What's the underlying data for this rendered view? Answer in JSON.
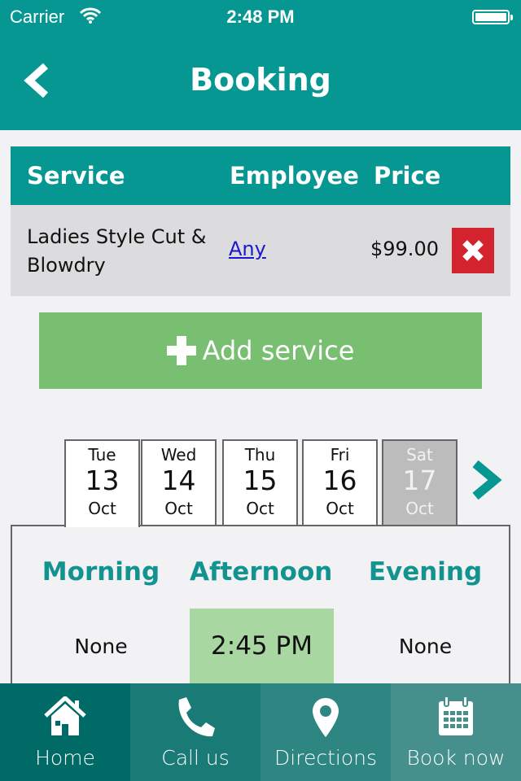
{
  "status_bar": {
    "carrier": "Carrier",
    "time": "2:48 PM",
    "battery": "full"
  },
  "nav": {
    "title": "Booking",
    "back_icon": "chevron-left-icon"
  },
  "services_table": {
    "headers": {
      "service": "Service",
      "employee": "Employee",
      "price": "Price"
    },
    "rows": [
      {
        "service": "Ladies Style Cut & Blowdry",
        "employee": "Any",
        "price": "$99.00",
        "delete_icon": "close-icon"
      }
    ]
  },
  "add_service": {
    "label": "Add service",
    "icon": "plus-icon"
  },
  "date_picker": {
    "days": [
      {
        "dow": "Tue",
        "day": "13",
        "month": "Oct",
        "state": "selected"
      },
      {
        "dow": "Wed",
        "day": "14",
        "month": "Oct",
        "state": "available"
      },
      {
        "dow": "Thu",
        "day": "15",
        "month": "Oct",
        "state": "available"
      },
      {
        "dow": "Fri",
        "day": "16",
        "month": "Oct",
        "state": "available"
      },
      {
        "dow": "Sat",
        "day": "17",
        "month": "Oct",
        "state": "disabled"
      }
    ],
    "next_icon": "chevron-right-icon"
  },
  "time_slots": {
    "periods": [
      {
        "label": "Morning",
        "slot": "None",
        "selected": false
      },
      {
        "label": "Afternoon",
        "slot": "2:45 PM",
        "selected": true
      },
      {
        "label": "Evening",
        "slot": "None",
        "selected": false
      }
    ]
  },
  "tab_bar": {
    "items": [
      {
        "label": "Home",
        "icon": "home-icon",
        "color": "#006b66"
      },
      {
        "label": "Call us",
        "icon": "phone-icon",
        "color": "#1a7a76"
      },
      {
        "label": "Directions",
        "icon": "map-pin-icon",
        "color": "#2e8683"
      },
      {
        "label": "Book now",
        "icon": "calendar-icon",
        "color": "#45908d"
      }
    ]
  },
  "colors": {
    "primary": "#069793",
    "add_button": "#79bf71",
    "delete": "#d3232f",
    "selected_slot": "#a8d7a1",
    "period_text": "#13938f"
  }
}
